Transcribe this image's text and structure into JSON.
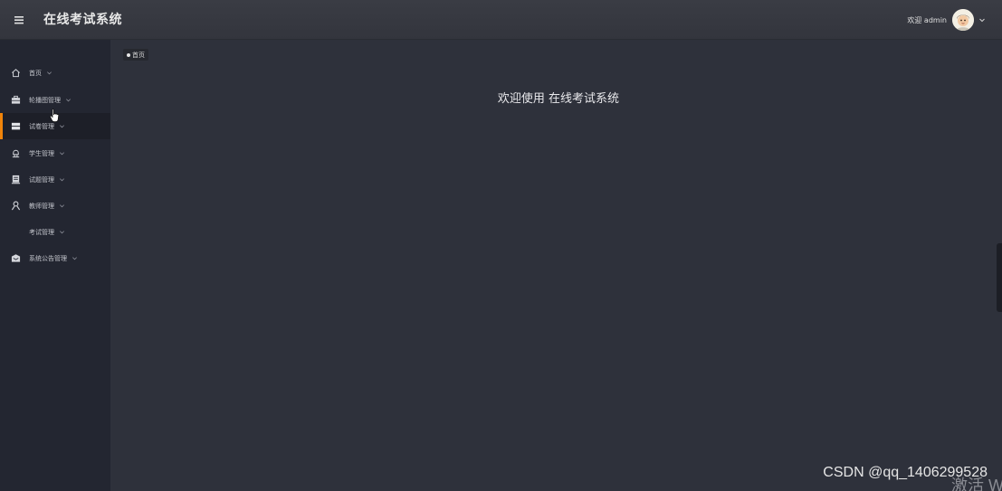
{
  "header": {
    "title": "在线考试系统",
    "welcome_user": "欢迎 admin",
    "menu_icon": "hamburger-icon"
  },
  "sidebar": {
    "items": [
      {
        "label": "首页",
        "icon": "home-icon"
      },
      {
        "label": "轮播图管理",
        "icon": "briefcase-icon"
      },
      {
        "label": "试卷管理",
        "icon": "grid-icon",
        "active": true
      },
      {
        "label": "学生管理",
        "icon": "student-icon"
      },
      {
        "label": "试题管理",
        "icon": "document-icon"
      },
      {
        "label": "教师管理",
        "icon": "user-icon"
      },
      {
        "label": "考试管理",
        "icon": ""
      },
      {
        "label": "系统公告管理",
        "icon": "inbox-icon"
      }
    ]
  },
  "breadcrumb": {
    "label": "首页"
  },
  "main": {
    "welcome": "欢迎使用 在线考试系统"
  },
  "overlay": {
    "watermark": "CSDN @qq_1406299528",
    "activate": "激活 Wi"
  },
  "colors": {
    "header_bg": "#383a42",
    "sidebar_bg": "#232631",
    "main_bg": "#2e313b",
    "accent": "#f0840a"
  }
}
